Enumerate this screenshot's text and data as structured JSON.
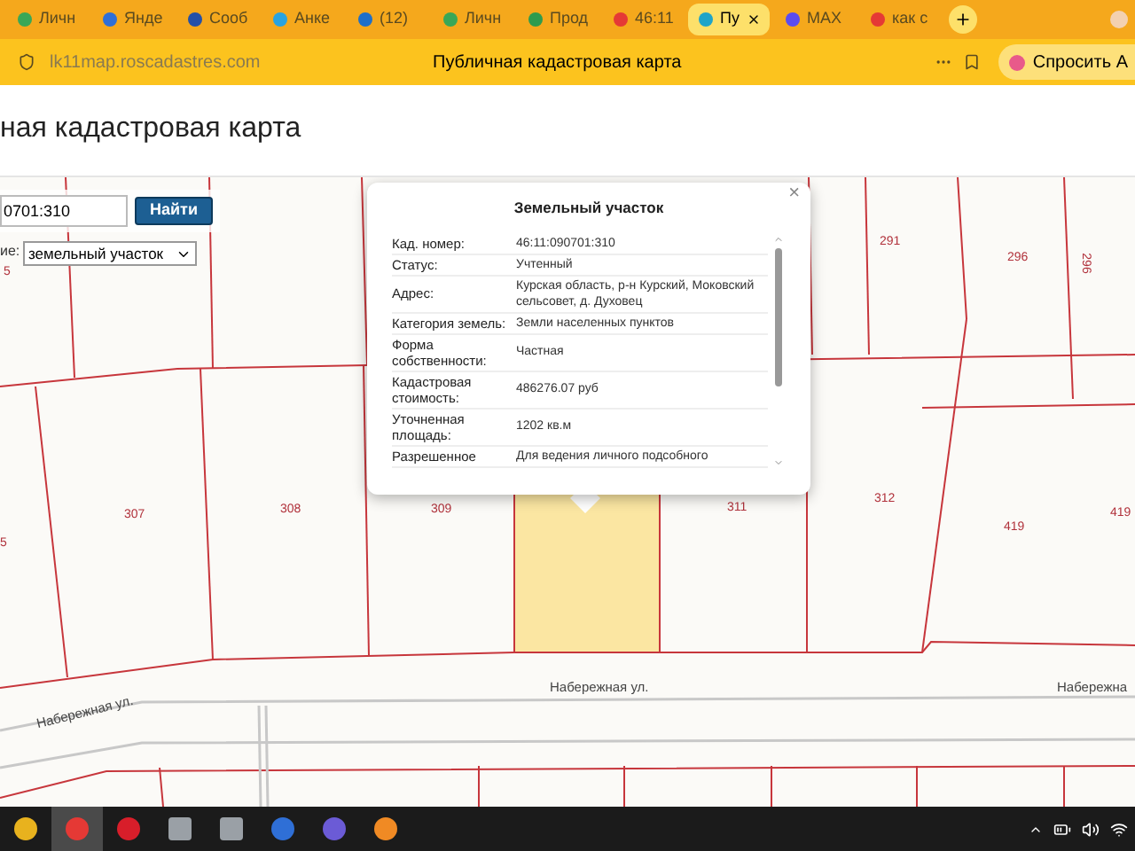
{
  "browser": {
    "tabs": [
      {
        "label": "Личн",
        "selected": false,
        "kind": "green"
      },
      {
        "label": "Янде",
        "selected": false,
        "kind": "blue"
      },
      {
        "label": "Сооб",
        "selected": false,
        "kind": "navy"
      },
      {
        "label": "Анке",
        "selected": false,
        "kind": "telegram"
      },
      {
        "label": "(12)",
        "selected": false,
        "kind": "mail"
      },
      {
        "label": "Личн",
        "selected": false,
        "kind": "green"
      },
      {
        "label": "Прод",
        "selected": false,
        "kind": "leaf"
      },
      {
        "label": "46:11",
        "selected": false,
        "kind": "yandex"
      },
      {
        "label": "Пу",
        "selected": true,
        "kind": "map"
      },
      {
        "label": "MAX",
        "selected": false,
        "kind": "max"
      },
      {
        "label": "как с",
        "selected": false,
        "kind": "yandex"
      }
    ],
    "address": "lk11map.roscadastres.com",
    "page_title": "Публичная кадастровая карта",
    "assistant_button": "Спросить А"
  },
  "page": {
    "heading": "ная кадастровая карта",
    "search": {
      "value": "0701:310",
      "button": "Найти"
    },
    "filter": {
      "label": "ие:",
      "value": "земельный участок"
    }
  },
  "map": {
    "parcels": [
      {
        "label": "5"
      },
      {
        "label": "291"
      },
      {
        "label": "296"
      },
      {
        "label": "296"
      },
      {
        "label": "307"
      },
      {
        "label": "308"
      },
      {
        "label": "309"
      },
      {
        "label": "311"
      },
      {
        "label": "312"
      },
      {
        "label": "419"
      },
      {
        "label": "419"
      },
      {
        "label": "5"
      }
    ],
    "streets": [
      {
        "label": "Набережная ул."
      },
      {
        "label": "Набережная ул."
      },
      {
        "label": "Набережна"
      }
    ]
  },
  "popup": {
    "title": "Земельный участок",
    "close": "×",
    "rows": [
      {
        "label": "Кад. номер:",
        "value": "46:11:090701:310"
      },
      {
        "label": "Статус:",
        "value": "Учтенный"
      },
      {
        "label": "Адрес:",
        "value": "Курская область, р-н Курский, Моковский сельсовет, д. Духовец"
      },
      {
        "label": "Категория земель:",
        "value": "Земли населенных пунктов"
      },
      {
        "label": "Форма собственности:",
        "value": "Частная"
      },
      {
        "label": "Кадастровая стоимость:",
        "value": "486276.07 руб"
      },
      {
        "label": "Уточненная площадь:",
        "value": "1202 кв.м"
      },
      {
        "label": "Разрешенное",
        "value": "Для ведения личного подсобного"
      }
    ]
  },
  "taskbar": {
    "apps": [
      {
        "kind": "chrome",
        "selected": false
      },
      {
        "kind": "yandex",
        "selected": true
      },
      {
        "kind": "opera",
        "selected": false
      },
      {
        "kind": "shield",
        "selected": false
      },
      {
        "kind": "castle",
        "selected": false
      },
      {
        "kind": "ybrowser",
        "selected": false
      },
      {
        "kind": "gamepad",
        "selected": false
      },
      {
        "kind": "heart",
        "selected": false
      }
    ]
  }
}
